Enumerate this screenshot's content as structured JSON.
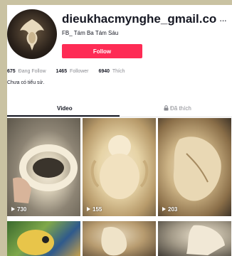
{
  "profile": {
    "username": "dieukhacmynghe_gmail.coi",
    "more_icon": "ellipsis-icon",
    "nickname": "FB_ Tám Ba Tám Sáu",
    "follow_label": "Follow",
    "bio": "Chưa có tiểu sử."
  },
  "stats": {
    "following_count": "675",
    "following_label": "Đang Follow",
    "followers_count": "1465",
    "followers_label": "Follower",
    "likes_count": "6940",
    "likes_label": "Thích"
  },
  "tabs": {
    "video": "Video",
    "liked": "Đã thích",
    "liked_icon": "lock-icon"
  },
  "videos": [
    {
      "views": "730"
    },
    {
      "views": "155"
    },
    {
      "views": "203"
    },
    {
      "views": ""
    },
    {
      "views": ""
    },
    {
      "views": ""
    }
  ],
  "colors": {
    "follow_button": "#fe2c55",
    "text_primary": "#161823",
    "text_secondary": "#8a8b91",
    "background_outer": "#c9c2a2"
  }
}
